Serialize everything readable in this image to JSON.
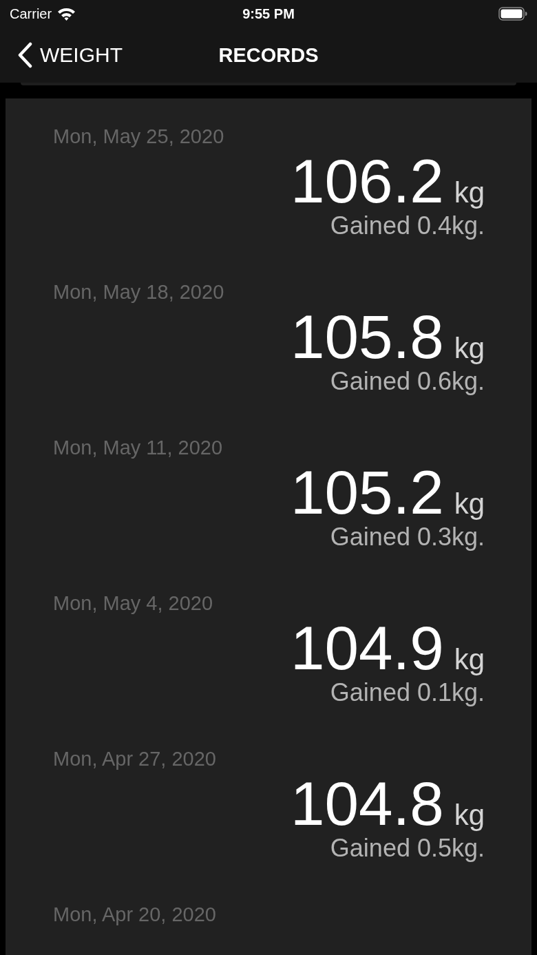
{
  "status_bar": {
    "carrier": "Carrier",
    "time": "9:55 PM"
  },
  "nav_bar": {
    "back_label": "WEIGHT",
    "title": "RECORDS"
  },
  "records": [
    {
      "date": "Mon, May 25, 2020",
      "weight": "106.2",
      "unit": "kg",
      "change": "Gained 0.4kg."
    },
    {
      "date": "Mon, May 18, 2020",
      "weight": "105.8",
      "unit": "kg",
      "change": "Gained 0.6kg."
    },
    {
      "date": "Mon, May 11, 2020",
      "weight": "105.2",
      "unit": "kg",
      "change": "Gained 0.3kg."
    },
    {
      "date": "Mon, May 4, 2020",
      "weight": "104.9",
      "unit": "kg",
      "change": "Gained 0.1kg."
    },
    {
      "date": "Mon, Apr 27, 2020",
      "weight": "104.8",
      "unit": "kg",
      "change": "Gained 0.5kg."
    },
    {
      "date": "Mon, Apr 20, 2020"
    }
  ]
}
